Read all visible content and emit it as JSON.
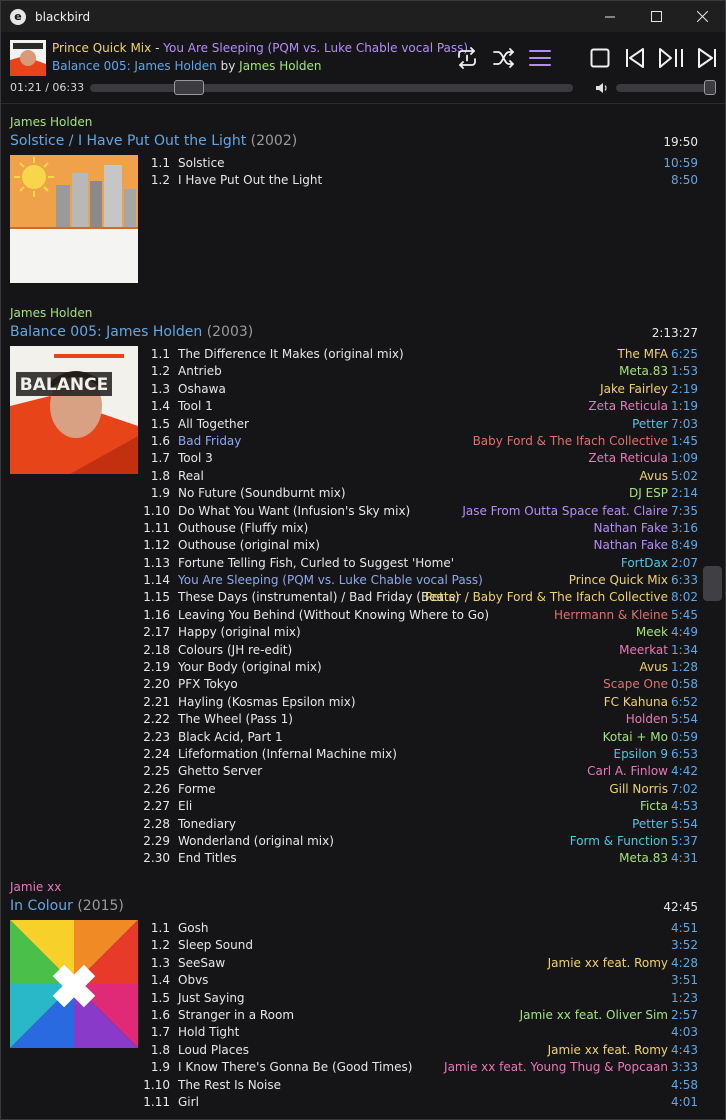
{
  "window": {
    "title": "blackbird",
    "app_icon": "e"
  },
  "now_playing": {
    "artist": "Prince Quick Mix",
    "separator": "-",
    "title": "You Are Sleeping (PQM vs. Luke Chable vocal Pass)",
    "album": "Balance 005: James Holden",
    "by": "by",
    "album_artist": "James Holden",
    "time": "01:21 / 06:33",
    "progress": 0.206,
    "volume": 1.0
  },
  "controls": [
    "repeat-icon",
    "shuffle-icon",
    "menu-icon",
    "stop-icon",
    "previous-icon",
    "play-pause-icon",
    "next-icon"
  ],
  "colors": {
    "yellow": "#f0d46a",
    "purple": "#b48ef7",
    "blue": "#5fa8e6",
    "green": "#a4e27a",
    "pink": "#e879b8",
    "red": "#e07070",
    "cyan": "#4fc7e0"
  },
  "albums": [
    {
      "artist": "James Holden",
      "artist_color": "#a4e27a",
      "title": "Solstice / I Have Put Out the Light",
      "year": "(2002)",
      "duration": "19:50",
      "tracks": [
        {
          "num": "1.1",
          "title": "Solstice",
          "artist": "",
          "dur": "10:59"
        },
        {
          "num": "1.2",
          "title": "I Have Put Out the Light",
          "artist": "",
          "dur": "8:50"
        }
      ]
    },
    {
      "artist": "James Holden",
      "artist_color": "#a4e27a",
      "title": "Balance 005: James Holden",
      "year": "(2003)",
      "duration": "2:13:27",
      "tracks": [
        {
          "num": "1.1",
          "title": "The Difference It Makes (original mix)",
          "artist": "The MFA",
          "color": "#f0d46a",
          "dur": "6:25"
        },
        {
          "num": "1.2",
          "title": "Antrieb",
          "artist": "Meta.83",
          "color": "#a4e27a",
          "dur": "1:53"
        },
        {
          "num": "1.3",
          "title": "Oshawa",
          "artist": "Jake Fairley",
          "color": "#f0d46a",
          "dur": "2:19"
        },
        {
          "num": "1.4",
          "title": "Tool 1",
          "artist": "Zeta Reticula",
          "color": "#e879b8",
          "dur": "1:19"
        },
        {
          "num": "1.5",
          "title": "All Together",
          "artist": "Petter",
          "color": "#4fc7e0",
          "dur": "7:03"
        },
        {
          "num": "1.6",
          "title": "Bad Friday",
          "artist": "Baby Ford & The Ifach Collective",
          "color": "#e07070",
          "dur": "1:45",
          "highlight": true
        },
        {
          "num": "1.7",
          "title": "Tool 3",
          "artist": "Zeta Reticula",
          "color": "#e879b8",
          "dur": "1:09"
        },
        {
          "num": "1.8",
          "title": "Real",
          "artist": "Avus",
          "color": "#f0d46a",
          "dur": "5:02"
        },
        {
          "num": "1.9",
          "title": "No Future (Soundburnt mix)",
          "artist": "DJ ESP",
          "color": "#a4e27a",
          "dur": "2:14"
        },
        {
          "num": "1.10",
          "title": "Do What You Want (Infusion's Sky mix)",
          "artist": "Jase From Outta Space feat. Claire",
          "color": "#b48ef7",
          "dur": "7:35"
        },
        {
          "num": "1.11",
          "title": "Outhouse (Fluffy mix)",
          "artist": "Nathan Fake",
          "color": "#b48ef7",
          "dur": "3:16"
        },
        {
          "num": "1.12",
          "title": "Outhouse (original mix)",
          "artist": "Nathan Fake",
          "color": "#b48ef7",
          "dur": "8:49"
        },
        {
          "num": "1.13",
          "title": "Fortune Telling Fish, Curled to Suggest 'Home'",
          "artist": "FortDax",
          "color": "#4fc7e0",
          "dur": "2:07"
        },
        {
          "num": "1.14",
          "title": "You Are Sleeping (PQM vs. Luke Chable vocal Pass)",
          "artist": "Prince Quick Mix",
          "color": "#f0d46a",
          "dur": "6:33",
          "playing": true
        },
        {
          "num": "1.15",
          "title": "These Days (instrumental) / Bad Friday (Beats)",
          "artist": "Petter / Baby Ford & The Ifach Collective",
          "color": "#f0d46a",
          "dur": "8:02"
        },
        {
          "num": "1.16",
          "title": "Leaving You Behind (Without Knowing Where to Go)",
          "artist": "Herrmann & Kleine",
          "color": "#e07070",
          "dur": "5:45"
        },
        {
          "num": "2.17",
          "title": "Happy (original mix)",
          "artist": "Meek",
          "color": "#a4e27a",
          "dur": "4:49"
        },
        {
          "num": "2.18",
          "title": "Colours (JH re-edit)",
          "artist": "Meerkat",
          "color": "#e879b8",
          "dur": "1:34"
        },
        {
          "num": "2.19",
          "title": "Your Body (original mix)",
          "artist": "Avus",
          "color": "#f0d46a",
          "dur": "1:28"
        },
        {
          "num": "2.20",
          "title": "PFX Tokyo",
          "artist": "Scape One",
          "color": "#e07070",
          "dur": "0:58"
        },
        {
          "num": "2.21",
          "title": "Hayling (Kosmas Epsilon mix)",
          "artist": "FC Kahuna",
          "color": "#f0d46a",
          "dur": "6:52"
        },
        {
          "num": "2.22",
          "title": "The Wheel (Pass 1)",
          "artist": "Holden",
          "color": "#e879b8",
          "dur": "5:54"
        },
        {
          "num": "2.23",
          "title": "Black Acid, Part 1",
          "artist": "Kotai + Mo",
          "color": "#a4e27a",
          "dur": "0:59"
        },
        {
          "num": "2.24",
          "title": "Lifeformation (Infernal Machine mix)",
          "artist": "Epsilon 9",
          "color": "#4fc7e0",
          "dur": "6:53"
        },
        {
          "num": "2.25",
          "title": "Ghetto Server",
          "artist": "Carl A. Finlow",
          "color": "#e879b8",
          "dur": "4:42"
        },
        {
          "num": "2.26",
          "title": "Forme",
          "artist": "Gill Norris",
          "color": "#f0d46a",
          "dur": "7:02"
        },
        {
          "num": "2.27",
          "title": "Eli",
          "artist": "Ficta",
          "color": "#a4e27a",
          "dur": "4:53"
        },
        {
          "num": "2.28",
          "title": "Tonediary",
          "artist": "Petter",
          "color": "#4fc7e0",
          "dur": "5:54"
        },
        {
          "num": "2.29",
          "title": "Wonderland (original mix)",
          "artist": "Form & Function",
          "color": "#4fc7e0",
          "dur": "5:37"
        },
        {
          "num": "2.30",
          "title": "End Titles",
          "artist": "Meta.83",
          "color": "#a4e27a",
          "dur": "4:31"
        }
      ]
    },
    {
      "artist": "Jamie xx",
      "artist_color": "#e879b8",
      "title": "In Colour",
      "year": "(2015)",
      "duration": "42:45",
      "tracks": [
        {
          "num": "1.1",
          "title": "Gosh",
          "artist": "",
          "dur": "4:51"
        },
        {
          "num": "1.2",
          "title": "Sleep Sound",
          "artist": "",
          "dur": "3:52"
        },
        {
          "num": "1.3",
          "title": "SeeSaw",
          "artist": "Jamie xx feat. Romy",
          "color": "#f0d46a",
          "dur": "4:28"
        },
        {
          "num": "1.4",
          "title": "Obvs",
          "artist": "",
          "dur": "3:51"
        },
        {
          "num": "1.5",
          "title": "Just Saying",
          "artist": "",
          "dur": "1:23"
        },
        {
          "num": "1.6",
          "title": "Stranger in a Room",
          "artist": "Jamie xx feat. Oliver Sim",
          "color": "#a4e27a",
          "dur": "2:57"
        },
        {
          "num": "1.7",
          "title": "Hold Tight",
          "artist": "",
          "dur": "4:03"
        },
        {
          "num": "1.8",
          "title": "Loud Places",
          "artist": "Jamie xx feat. Romy",
          "color": "#f0d46a",
          "dur": "4:43"
        },
        {
          "num": "1.9",
          "title": "I Know There's Gonna Be (Good Times)",
          "artist": "Jamie xx feat. Young Thug & Popcaan",
          "color": "#e879b8",
          "dur": "3:33"
        },
        {
          "num": "1.10",
          "title": "The Rest Is Noise",
          "artist": "",
          "dur": "4:58"
        },
        {
          "num": "1.11",
          "title": "Girl",
          "artist": "",
          "dur": "4:01"
        }
      ]
    }
  ]
}
